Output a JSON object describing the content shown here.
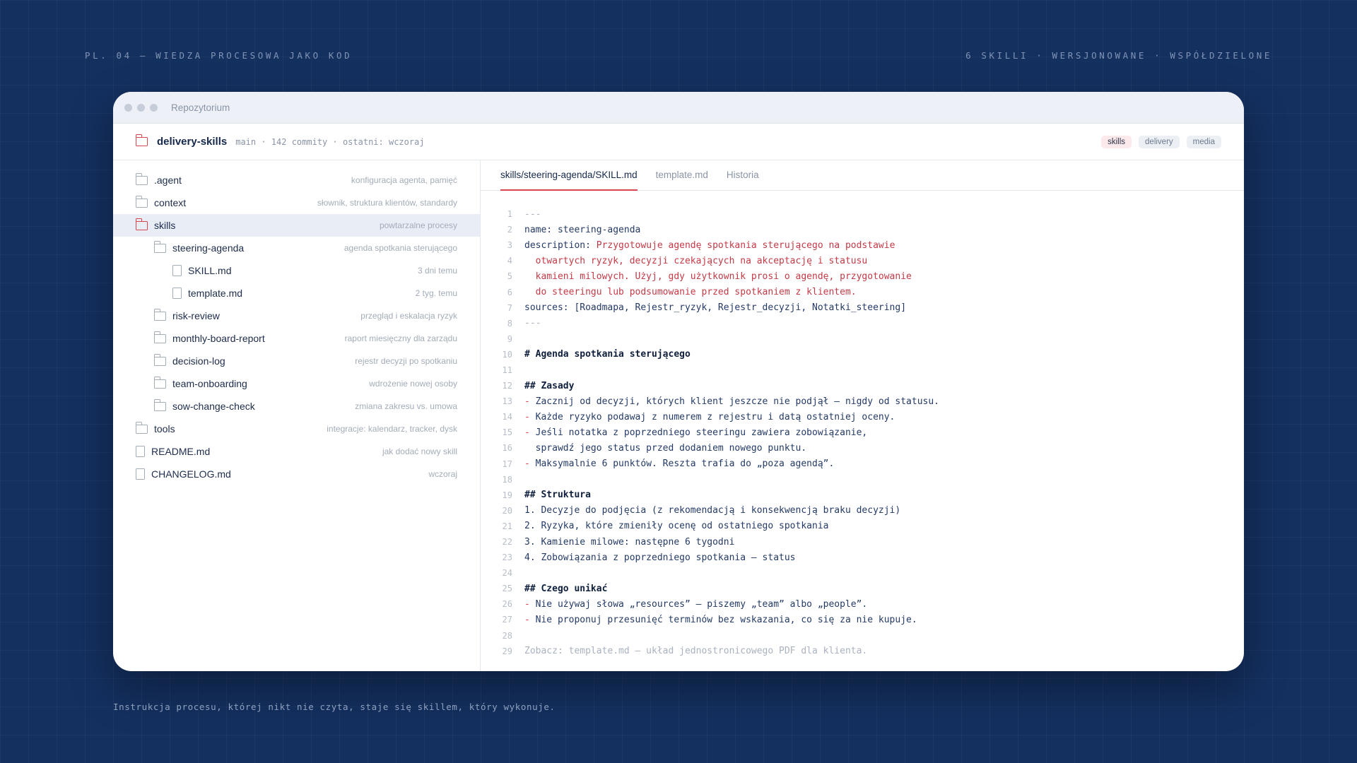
{
  "slide": {
    "top_left": "PL. 04 — WIEDZA PROCESOWA JAKO KOD",
    "top_right": "6 SKILLI · WERSJONOWANE · WSPÓŁDZIELONE",
    "caption": "Instrukcja procesu, której nikt nie czyta, staje się skillem, który wykonuje."
  },
  "window": {
    "title": "Repozytorium",
    "repo": {
      "name": "delivery-skills",
      "meta": "main · 142 commity · ostatni: wczoraj",
      "tags": [
        "skills",
        "delivery",
        "media"
      ],
      "active_tag": "skills"
    },
    "tree": [
      {
        "name": ".agent",
        "desc": "konfiguracja agenta, pamięć",
        "type": "folder",
        "depth": 0
      },
      {
        "name": "context",
        "desc": "słownik, struktura klientów, standardy",
        "type": "folder",
        "depth": 0
      },
      {
        "name": "skills",
        "desc": "powtarzalne procesy",
        "type": "folder",
        "depth": 0,
        "active": true
      },
      {
        "name": "steering-agenda",
        "desc": "agenda spotkania sterującego",
        "type": "folder",
        "depth": 1
      },
      {
        "name": "SKILL.md",
        "desc": "3 dni temu",
        "type": "file",
        "depth": 2
      },
      {
        "name": "template.md",
        "desc": "2 tyg. temu",
        "type": "file",
        "depth": 2
      },
      {
        "name": "risk-review",
        "desc": "przegląd i eskalacja ryzyk",
        "type": "folder",
        "depth": 1
      },
      {
        "name": "monthly-board-report",
        "desc": "raport miesięczny dla zarządu",
        "type": "folder",
        "depth": 1
      },
      {
        "name": "decision-log",
        "desc": "rejestr decyzji po spotkaniu",
        "type": "folder",
        "depth": 1
      },
      {
        "name": "team-onboarding",
        "desc": "wdrożenie nowej osoby",
        "type": "folder",
        "depth": 1
      },
      {
        "name": "sow-change-check",
        "desc": "zmiana zakresu vs. umowa",
        "type": "folder",
        "depth": 1
      },
      {
        "name": "tools",
        "desc": "integracje: kalendarz, tracker, dysk",
        "type": "folder",
        "depth": 0
      },
      {
        "name": "README.md",
        "desc": "jak dodać nowy skill",
        "type": "file",
        "depth": 0
      },
      {
        "name": "CHANGELOG.md",
        "desc": "wczoraj",
        "type": "file",
        "depth": 0
      }
    ],
    "tabs": [
      "skills/steering-agenda/SKILL.md",
      "template.md",
      "Historia"
    ],
    "active_tab": 0,
    "code": [
      {
        "n": "1",
        "t": "---",
        "s": "muted"
      },
      {
        "n": "2",
        "t": "name: steering-agenda",
        "s": ""
      },
      {
        "n": "3",
        "t": "description: Przygotowuje agendę spotkania sterującego na podstawie",
        "s": "desc"
      },
      {
        "n": "4",
        "t": "  otwartych ryzyk, decyzji czekających na akceptację i statusu",
        "s": "red"
      },
      {
        "n": "5",
        "t": "  kamieni milowych. Użyj, gdy użytkownik prosi o agendę, przygotowanie",
        "s": "red"
      },
      {
        "n": "6",
        "t": "  do steeringu lub podsumowanie przed spotkaniem z klientem.",
        "s": "red"
      },
      {
        "n": "7",
        "t": "sources: [Roadmapa, Rejestr_ryzyk, Rejestr_decyzji, Notatki_steering]",
        "s": ""
      },
      {
        "n": "8",
        "t": "---",
        "s": "muted"
      },
      {
        "n": "9",
        "t": "",
        "s": ""
      },
      {
        "n": "10",
        "t": "# Agenda spotkania sterującego",
        "s": "heading"
      },
      {
        "n": "11",
        "t": "",
        "s": ""
      },
      {
        "n": "12",
        "t": "## Zasady",
        "s": "heading"
      },
      {
        "n": "13",
        "t": "- Zacznij od decyzji, których klient jeszcze nie podjął — nigdy od statusu.",
        "s": "bullet"
      },
      {
        "n": "14",
        "t": "- Każde ryzyko podawaj z numerem z rejestru i datą ostatniej oceny.",
        "s": "bullet"
      },
      {
        "n": "15",
        "t": "- Jeśli notatka z poprzedniego steeringu zawiera zobowiązanie,",
        "s": "bullet"
      },
      {
        "n": "16",
        "t": "  sprawdź jego status przed dodaniem nowego punktu.",
        "s": ""
      },
      {
        "n": "17",
        "t": "- Maksymalnie 6 punktów. Reszta trafia do „poza agendą”.",
        "s": "bullet"
      },
      {
        "n": "18",
        "t": "",
        "s": ""
      },
      {
        "n": "19",
        "t": "## Struktura",
        "s": "heading"
      },
      {
        "n": "20",
        "t": "1. Decyzje do podjęcia (z rekomendacją i konsekwencją braku decyzji)",
        "s": ""
      },
      {
        "n": "21",
        "t": "2. Ryzyka, które zmieniły ocenę od ostatniego spotkania",
        "s": ""
      },
      {
        "n": "22",
        "t": "3. Kamienie milowe: następne 6 tygodni",
        "s": ""
      },
      {
        "n": "23",
        "t": "4. Zobowiązania z poprzedniego spotkania — status",
        "s": ""
      },
      {
        "n": "24",
        "t": "",
        "s": ""
      },
      {
        "n": "25",
        "t": "## Czego unikać",
        "s": "heading"
      },
      {
        "n": "26",
        "t": "- Nie używaj słowa „resources” — piszemy „team” albo „people”.",
        "s": "bullet"
      },
      {
        "n": "27",
        "t": "- Nie proponuj przesunięć terminów bez wskazania, co się za nie kupuje.",
        "s": "bullet"
      },
      {
        "n": "28",
        "t": "",
        "s": ""
      },
      {
        "n": "29",
        "t": "Zobacz: template.md — układ jednostronicowego PDF dla klienta.",
        "s": "muted"
      }
    ],
    "colors": {
      "accent": "#d64550",
      "code_text": "#243a66",
      "background": "#14305f"
    }
  }
}
